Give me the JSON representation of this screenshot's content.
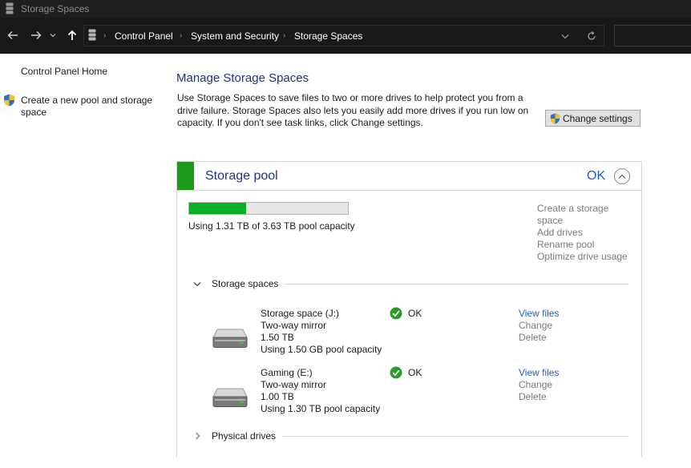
{
  "window": {
    "title": "Storage Spaces"
  },
  "nav": {
    "breadcrumbs": [
      "Control Panel",
      "System and Security",
      "Storage Spaces"
    ],
    "icons": {
      "back": "arrow-left-icon",
      "forward": "arrow-right-icon",
      "recent": "chevron-down-icon",
      "up": "arrow-up-icon",
      "dropdown": "chevron-down-icon",
      "refresh": "refresh-icon"
    }
  },
  "sidebar": {
    "home_link": "Control Panel Home",
    "create_pool_link_line1": "Create a new pool and storage",
    "create_pool_link_line2": "space"
  },
  "main": {
    "title": "Manage Storage Spaces",
    "description_lines": [
      "Use Storage Spaces to save files to two or more drives to help protect you from a",
      "drive failure. Storage Spaces also lets you easily add more drives if you run low on",
      "capacity. If you don't see task links, click Change settings."
    ],
    "change_settings_label": "Change settings"
  },
  "pool": {
    "name": "Storage pool",
    "status": "OK",
    "capacity_used_fraction": 0.361,
    "capacity_text": "Using 1.31 TB of 3.63 TB pool capacity",
    "tasks": {
      "create_line1": "Create a storage",
      "create_line2": "space",
      "add_drives": "Add drives",
      "rename": "Rename pool",
      "optimize": "Optimize drive usage"
    },
    "storage_spaces_header": "Storage spaces",
    "physical_drives_header": "Physical drives",
    "spaces": [
      {
        "name": "Storage space (J:)",
        "resiliency": "Two-way mirror",
        "size": "1.50 TB",
        "usage": "Using 1.50 GB pool capacity",
        "status": "OK",
        "view_files": "View files",
        "change": "Change",
        "delete": "Delete"
      },
      {
        "name": "Gaming (E:)",
        "resiliency": "Two-way mirror",
        "size": "1.00 TB",
        "usage": "Using 1.30 TB pool capacity",
        "status": "OK",
        "view_files": "View files",
        "change": "Change",
        "delete": "Delete"
      }
    ]
  },
  "colors": {
    "accent_blue": "#1e3287",
    "link_blue": "#1e5fc7",
    "capacity_green": "#06b025",
    "pool_strip_green": "#1c9a1c",
    "titlebar_bg": "#1f1f1f",
    "navbar_bg": "#191919"
  }
}
